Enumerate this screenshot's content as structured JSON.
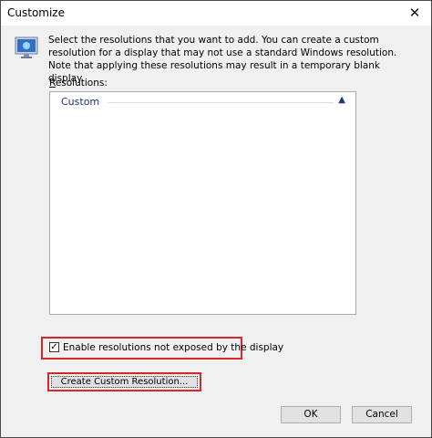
{
  "window": {
    "title": "Customize"
  },
  "description": "Select the resolutions that you want to add. You can create a custom resolution for a display that may not use a standard Windows resolution. Note that applying these resolutions may result in a temporary blank display.",
  "resolutions": {
    "label_accesskey": "R",
    "label_rest": "esolutions:",
    "group_label": "Custom"
  },
  "enable_checkbox": {
    "checked": true,
    "label": "Enable resolutions not exposed by the display"
  },
  "buttons": {
    "create_custom": "Create Custom Resolution...",
    "ok": "OK",
    "cancel": "Cancel"
  },
  "colors": {
    "highlight_border": "#d9262c",
    "group_text": "#1e3287"
  }
}
